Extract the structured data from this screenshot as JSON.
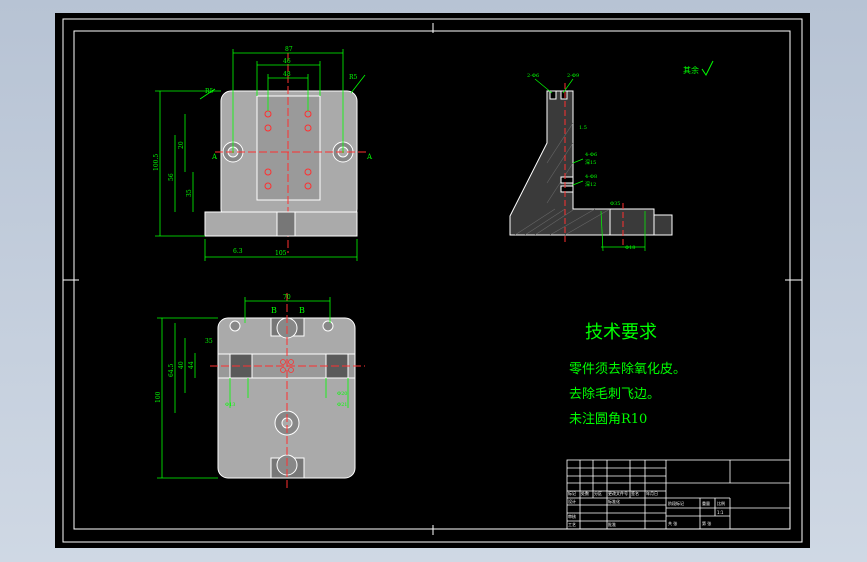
{
  "drawing": {
    "roughness_symbol": "其余",
    "tech_req": {
      "title": "技术要求",
      "lines": [
        "零件须去除氧化皮。",
        "去除毛刺飞边。",
        "未注圆角R10"
      ]
    },
    "front_view": {
      "width_dims": [
        "87",
        "46",
        "48"
      ],
      "height_dims": [
        "100.5",
        "56",
        "20",
        "35",
        "28.5",
        "15.5",
        "16",
        "6"
      ],
      "bottom_dim": "105",
      "roughness": "6.3",
      "radius": "R5",
      "section": "A",
      "section_right": "A",
      "arrow_label": "↓"
    },
    "side_view": {
      "top_labels": [
        "2-Φ6",
        "2-Φ9"
      ],
      "side_labels": [
        "4-Φ6",
        "深15",
        "4-Φ8",
        "深12"
      ],
      "bottom_labels": [
        "Φ35",
        "Φ18"
      ],
      "small_label": "1.5"
    },
    "top_view": {
      "top_dim": "70",
      "sec_left": "B",
      "sec_right": "B",
      "left_dims": [
        "100",
        "64.5",
        "40",
        "44",
        "35"
      ],
      "bottom_labels": [
        "Φ13",
        "Φ20",
        "Φ21"
      ]
    },
    "title_block": {
      "cells": [
        "标记",
        "处数",
        "分区",
        "更改文件号",
        "签名",
        "年月日",
        "设计",
        "标准化",
        "审核",
        "工艺",
        "批准",
        "阶段标记",
        "重量",
        "比例",
        "共 张",
        "第 张",
        "1:1"
      ]
    }
  }
}
